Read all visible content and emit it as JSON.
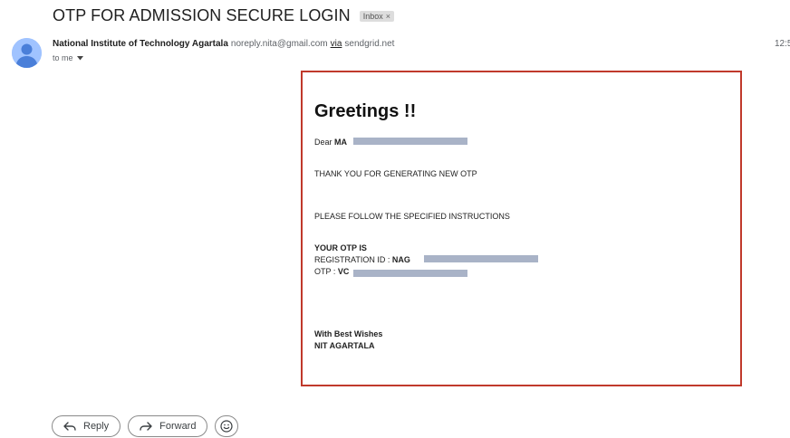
{
  "email": {
    "subject": "OTP FOR ADMISSION SECURE LOGIN",
    "label_badge": "Inbox",
    "label_badge_close": "×",
    "sender_name": "National Institute of Technology Agartala",
    "sender_email": "noreply.nita@gmail.com",
    "via_label": "via",
    "via_domain": "sendgrid.net",
    "recipient": "to me",
    "time": "12:5"
  },
  "message": {
    "greeting": "Greetings !!",
    "dear_prefix": "Dear ",
    "dear_name_partial": "MA",
    "thank_you": "THANK YOU FOR GENERATING NEW OTP",
    "instructions": "PLEASE FOLLOW THE SPECIFIED INSTRUCTIONS",
    "otp_heading": "YOUR OTP IS",
    "registration_label": "REGISTRATION ID : ",
    "registration_value_partial": "NAG",
    "otp_label": "OTP : ",
    "otp_value_partial": "VC",
    "sign_off": "With Best Wishes",
    "signature": "NIT AGARTALA"
  },
  "actions": {
    "reply_label": "Reply",
    "forward_label": "Forward"
  },
  "icons": {
    "avatar": "person-avatar-icon",
    "reply": "reply-arrow-icon",
    "forward": "forward-arrow-icon",
    "emoji": "emoji-smile-icon",
    "caret": "chevron-down-icon"
  },
  "colors": {
    "avatar_bg": "#a0c3ff",
    "avatar_fg": "#4a7fd9",
    "frame_border": "#c0392b",
    "redaction": "#a9b3c7"
  }
}
